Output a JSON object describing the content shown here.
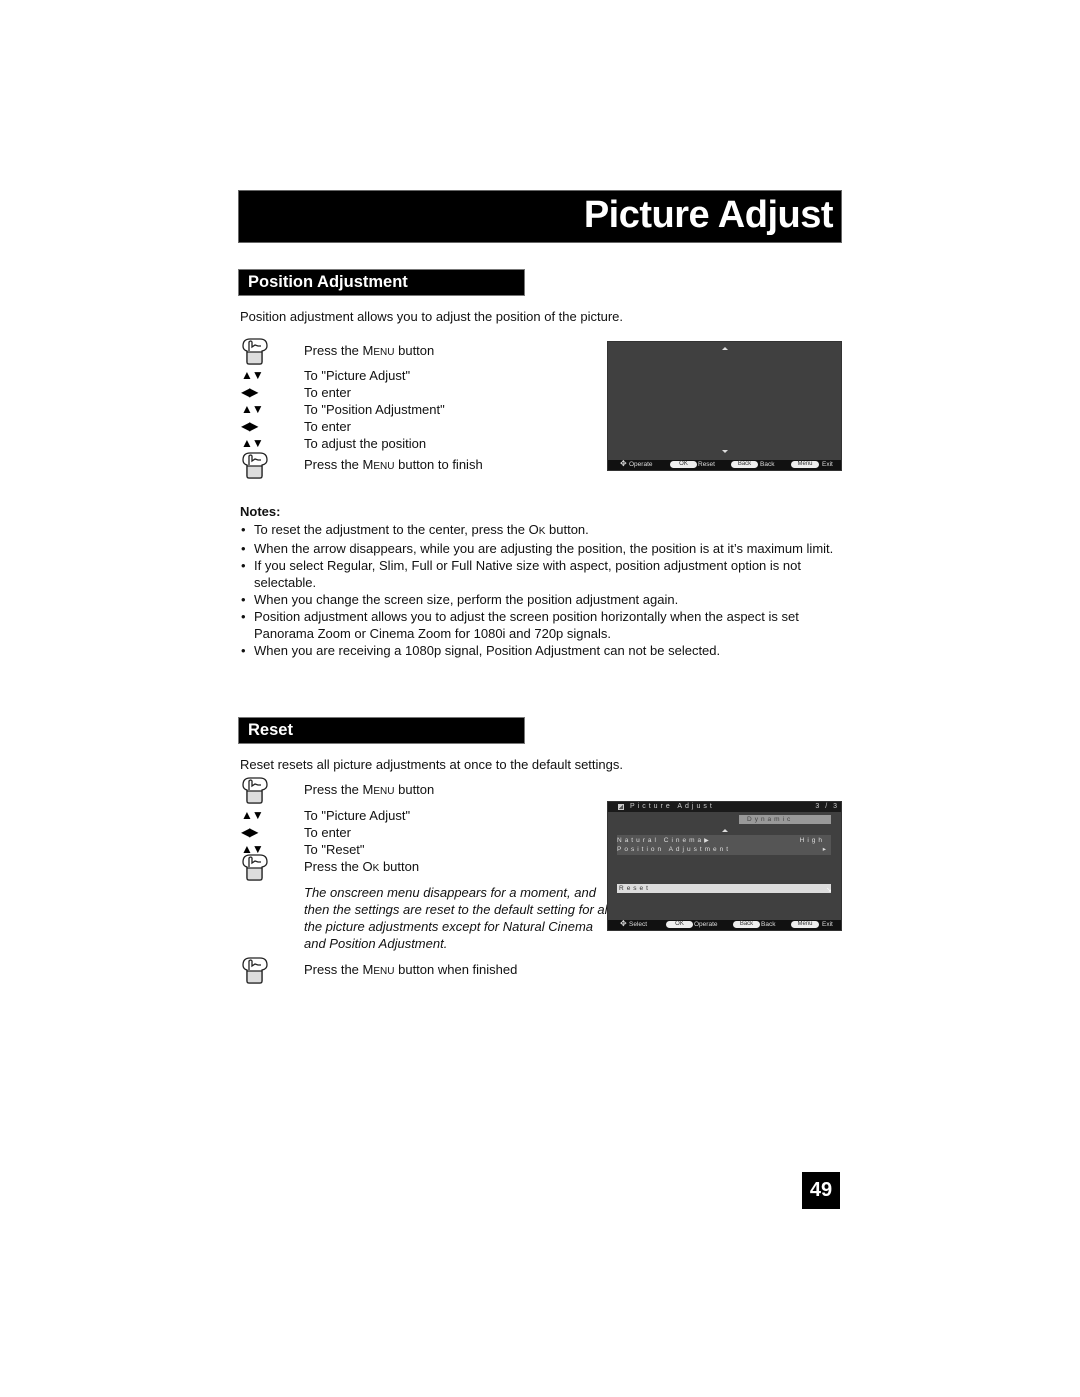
{
  "page": {
    "title": "Picture Adjust",
    "page_number": "49"
  },
  "position_adjustment": {
    "heading": "Position Adjustment",
    "intro": "Position adjustment allows you to adjust the position of the picture.",
    "steps": [
      {
        "icon": "hand-press-icon",
        "pre": "Press the ",
        "key": "Menu",
        "post": " button"
      },
      {
        "icon": "up-down-arrows-icon",
        "text": "To \"Picture Adjust\""
      },
      {
        "icon": "left-right-arrows-icon",
        "text": "To enter"
      },
      {
        "icon": "up-down-arrows-icon",
        "text": "To \"Position Adjustment\""
      },
      {
        "icon": "left-right-arrows-icon",
        "text": "To enter"
      },
      {
        "icon": "up-down-arrows-icon",
        "text": "To adjust the position"
      },
      {
        "icon": "hand-press-icon",
        "pre": "Press the ",
        "key": "Menu",
        "post": " button to finish"
      }
    ],
    "notes_title": "Notes:",
    "notes": [
      {
        "pre": "To reset the adjustment to the center, press the ",
        "key": "Ok",
        "post": " button."
      },
      {
        "text": "When the arrow disappears, while you are adjusting the position, the position is at it’s maximum limit."
      },
      {
        "text": "If you select Regular, Slim, Full or Full Native size with aspect, position adjustment option is not selectable."
      },
      {
        "text": "When you change the screen size, perform the position adjustment again."
      },
      {
        "text": "Position adjustment allows you to adjust the screen position horizontally when the aspect is set Panorama Zoom or Cinema Zoom for 1080i and 720p signals."
      },
      {
        "text": "When you are receiving a 1080p signal, Position Adjustment can not be selected."
      }
    ],
    "screen": {
      "footer": {
        "nav_label": "Operate",
        "ok_key": "OK",
        "ok_label": "Reset",
        "back_key": "Back",
        "back_label": "Back",
        "menu_key": "Menu",
        "menu_label": "Exit"
      }
    }
  },
  "reset": {
    "heading": "Reset",
    "intro": "Reset resets all picture adjustments at once to the default settings.",
    "steps": [
      {
        "icon": "hand-press-icon",
        "pre": "Press the ",
        "key": "Menu",
        "post": " button"
      },
      {
        "icon": "up-down-arrows-icon",
        "text": "To \"Picture Adjust\""
      },
      {
        "icon": "left-right-arrows-icon",
        "text": "To enter"
      },
      {
        "icon": "up-down-arrows-icon",
        "text": "To \"Reset\""
      },
      {
        "icon": "hand-press-icon",
        "pre": "Press the ",
        "key": "Ok",
        "post": " button"
      },
      {
        "icon": "hand-press-icon",
        "pre": "Press the ",
        "key": "Menu",
        "post": " button when finished"
      }
    ],
    "note": "The onscreen menu disappears for a moment, and then the settings are reset to the default setting for all the picture adjustments except for Natural Cinema and Position Adjustment.",
    "screen": {
      "menu_title": "Picture Adjust",
      "page_indicator": "3 / 3",
      "mode": "Dynamic",
      "rows": [
        {
          "label": "Natural Cinema",
          "value": "High"
        },
        {
          "label": "Position Adjustment",
          "value": "▸"
        }
      ],
      "selected_row": "Reset",
      "footer": {
        "nav_label": "Select",
        "ok_key": "OK",
        "ok_label": "Operate",
        "back_key": "Back",
        "back_label": "Back",
        "menu_key": "Menu",
        "menu_label": "Exit"
      }
    }
  }
}
